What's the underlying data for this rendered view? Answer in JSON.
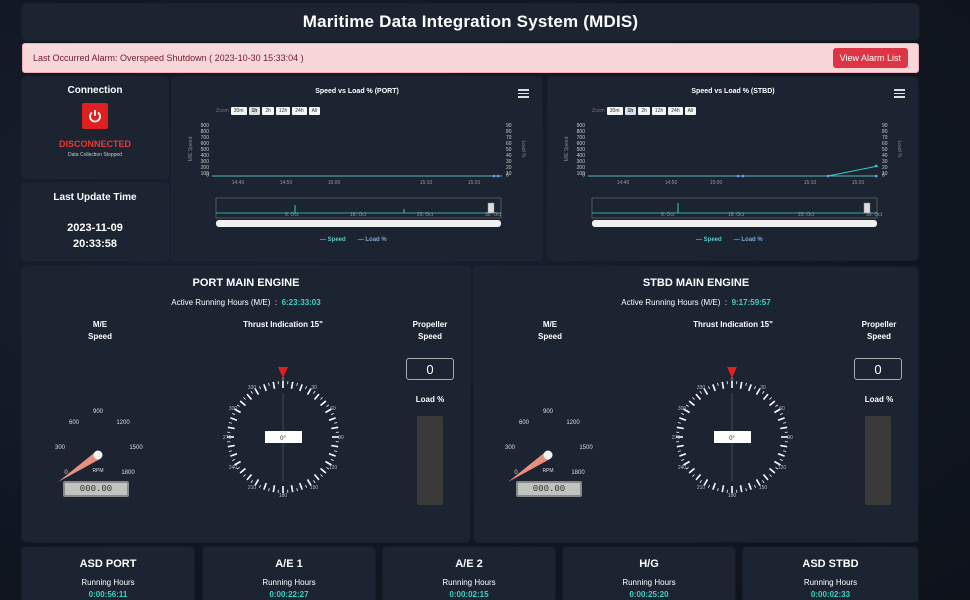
{
  "app": {
    "title": "Maritime Data Integration System (MDIS)"
  },
  "alarm": {
    "text": "Last Occurred Alarm: Overspeed Shutdown ( 2023-10-30 15:33:04 )",
    "button": "View Alarm List"
  },
  "connection": {
    "title": "Connection",
    "icon": "power-icon",
    "status": "DISCONNECTED",
    "sub": "Data Collection Stopped",
    "status_color": "#e53935"
  },
  "last_update": {
    "title": "Last Update Time",
    "date": "2023-11-09",
    "time": "20:33:58"
  },
  "charts": {
    "port": {
      "title": "Speed vs Load % (PORT)",
      "zoom_label": "Zoom",
      "zoom": [
        "30m",
        "1h",
        "2h",
        "12h",
        "24h",
        "All"
      ],
      "zoom_selected": "1h",
      "y_left": [
        "900",
        "800",
        "700",
        "600",
        "500",
        "400",
        "300",
        "200",
        "100",
        "0"
      ],
      "y_right": [
        "90",
        "80",
        "70",
        "60",
        "50",
        "40",
        "30",
        "20",
        "10",
        "0"
      ],
      "y_left_label": "M/E Speed",
      "y_right_label": "Load %",
      "x_ticks": [
        "14:40",
        "14:50",
        "15:00",
        "15:10",
        "15:20"
      ],
      "nav_ticks": [
        "9. Oct",
        "16. Oct",
        "23. Oct",
        "30. Oct"
      ],
      "legend": [
        "Speed",
        "Load %"
      ]
    },
    "stbd": {
      "title": "Speed vs Load % (STBD)",
      "zoom_label": "Zoom",
      "zoom": [
        "30m",
        "1h",
        "2h",
        "12h",
        "24h",
        "All"
      ],
      "zoom_selected": "1h",
      "y_left": [
        "900",
        "800",
        "700",
        "600",
        "500",
        "400",
        "300",
        "200",
        "100",
        "0"
      ],
      "y_right": [
        "90",
        "80",
        "70",
        "60",
        "50",
        "40",
        "30",
        "20",
        "10",
        "0"
      ],
      "y_left_label": "M/E Speed",
      "y_right_label": "Load %",
      "x_ticks": [
        "14:40",
        "14:50",
        "15:00",
        "15:10",
        "15:20"
      ],
      "nav_ticks": [
        "9. Oct",
        "16. Oct",
        "23. Oct",
        "30. Oct"
      ],
      "legend": [
        "Speed",
        "Load %"
      ]
    }
  },
  "engines": {
    "port": {
      "title": "PORT MAIN ENGINE",
      "arh_label": "Active Running Hours (M/E)",
      "arh_value": "6:23:33:03",
      "me_speed_label": [
        "M/E",
        "Speed"
      ],
      "thrust_label": "Thrust Indication 15\"",
      "thrust_value": "0°",
      "prop_label": [
        "Propeller",
        "Speed"
      ],
      "prop_value": "0",
      "load_label": "Load %",
      "rpm_label": "RPM",
      "rpm_value": "000.00",
      "rpm_ticks": [
        "0",
        "300",
        "600",
        "900",
        "1200",
        "1500",
        "1800"
      ]
    },
    "stbd": {
      "title": "STBD MAIN ENGINE",
      "arh_label": "Active Running Hours (M/E)",
      "arh_value": "9:17:59:57",
      "me_speed_label": [
        "M/E",
        "Speed"
      ],
      "thrust_label": "Thrust Indication 15\"",
      "thrust_value": "0°",
      "prop_label": [
        "Propeller",
        "Speed"
      ],
      "prop_value": "0",
      "load_label": "Load %",
      "rpm_label": "RPM",
      "rpm_value": "000.00",
      "rpm_ticks": [
        "0",
        "300",
        "600",
        "900",
        "1200",
        "1500",
        "1800"
      ]
    }
  },
  "compass_labels": [
    "0",
    "30",
    "60",
    "90",
    "120",
    "150",
    "180",
    "210",
    "240",
    "270",
    "300",
    "330"
  ],
  "cards": [
    {
      "title": "ASD PORT",
      "label": "Running Hours",
      "value": "0:00:56:11"
    },
    {
      "title": "A/E 1",
      "label": "Running Hours",
      "value": "0:00:22:27"
    },
    {
      "title": "A/E 2",
      "label": "Running Hours",
      "value": "0:00:02:15"
    },
    {
      "title": "H/G",
      "label": "Running Hours",
      "value": "0:00:25:20"
    },
    {
      "title": "ASD STBD",
      "label": "Running Hours",
      "value": "0:00:02:33"
    }
  ],
  "chart_data": [
    {
      "type": "line",
      "title": "Speed vs Load % (PORT)",
      "x": [
        "14:40",
        "14:50",
        "15:00",
        "15:10",
        "15:20"
      ],
      "series": [
        {
          "name": "Speed",
          "values": [
            0,
            0,
            0,
            0,
            0
          ]
        },
        {
          "name": "Load %",
          "values": [
            0,
            0,
            0,
            0,
            0
          ]
        }
      ],
      "ylim": [
        0,
        900
      ],
      "y2lim": [
        0,
        90
      ],
      "legend": "bottom"
    },
    {
      "type": "line",
      "title": "Speed vs Load % (STBD)",
      "x": [
        "14:40",
        "14:50",
        "15:00",
        "15:10",
        "15:20"
      ],
      "series": [
        {
          "name": "Speed",
          "values": [
            0,
            0,
            0,
            0,
            100
          ]
        },
        {
          "name": "Load %",
          "values": [
            0,
            0,
            0,
            0,
            0
          ]
        }
      ],
      "ylim": [
        0,
        900
      ],
      "y2lim": [
        0,
        90
      ],
      "legend": "bottom"
    }
  ]
}
